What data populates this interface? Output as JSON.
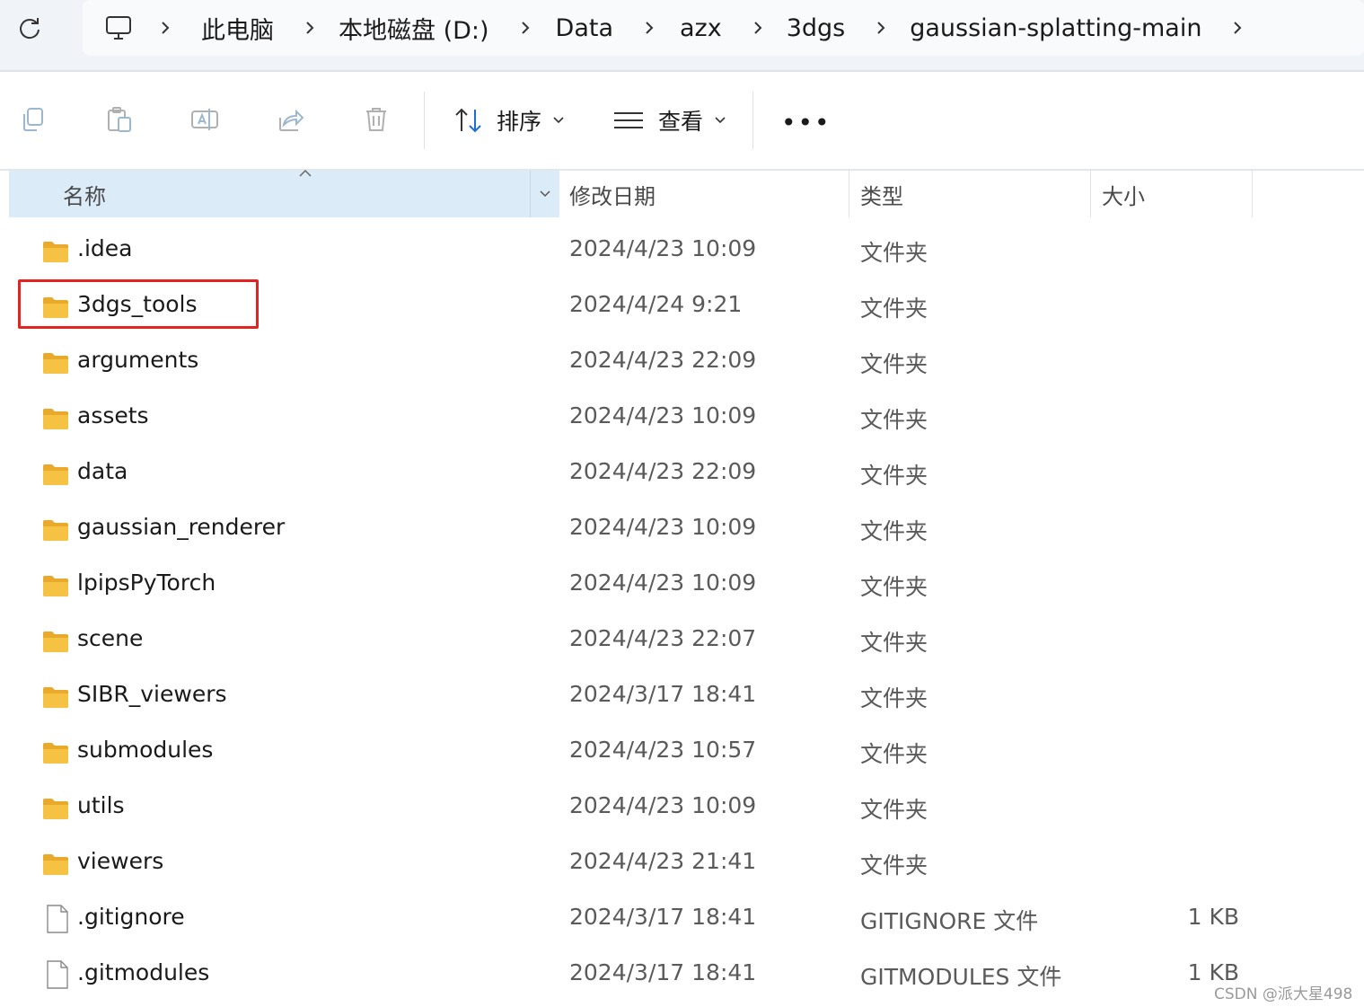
{
  "breadcrumb": {
    "items": [
      "此电脑",
      "本地磁盘 (D:)",
      "Data",
      "azx",
      "3dgs",
      "gaussian-splatting-main"
    ]
  },
  "toolbar": {
    "sort_label": "排序",
    "view_label": "查看",
    "more_label": "•••"
  },
  "columns": {
    "name": "名称",
    "date": "修改日期",
    "type": "类型",
    "size": "大小"
  },
  "rows": [
    {
      "name": ".idea",
      "date": "2024/4/23 10:09",
      "type": "文件夹",
      "size": "",
      "icon": "folder-icon"
    },
    {
      "name": "3dgs_tools",
      "date": "2024/4/24 9:21",
      "type": "文件夹",
      "size": "",
      "icon": "folder-icon"
    },
    {
      "name": "arguments",
      "date": "2024/4/23 22:09",
      "type": "文件夹",
      "size": "",
      "icon": "folder-icon"
    },
    {
      "name": "assets",
      "date": "2024/4/23 10:09",
      "type": "文件夹",
      "size": "",
      "icon": "folder-icon"
    },
    {
      "name": "data",
      "date": "2024/4/23 22:09",
      "type": "文件夹",
      "size": "",
      "icon": "folder-icon"
    },
    {
      "name": "gaussian_renderer",
      "date": "2024/4/23 10:09",
      "type": "文件夹",
      "size": "",
      "icon": "folder-icon"
    },
    {
      "name": "lpipsPyTorch",
      "date": "2024/4/23 10:09",
      "type": "文件夹",
      "size": "",
      "icon": "folder-icon"
    },
    {
      "name": "scene",
      "date": "2024/4/23 22:07",
      "type": "文件夹",
      "size": "",
      "icon": "folder-icon"
    },
    {
      "name": "SIBR_viewers",
      "date": "2024/3/17 18:41",
      "type": "文件夹",
      "size": "",
      "icon": "folder-icon"
    },
    {
      "name": "submodules",
      "date": "2024/4/23 10:57",
      "type": "文件夹",
      "size": "",
      "icon": "folder-icon"
    },
    {
      "name": "utils",
      "date": "2024/4/23 10:09",
      "type": "文件夹",
      "size": "",
      "icon": "folder-icon"
    },
    {
      "name": "viewers",
      "date": "2024/4/23 21:41",
      "type": "文件夹",
      "size": "",
      "icon": "folder-icon"
    },
    {
      "name": ".gitignore",
      "date": "2024/3/17 18:41",
      "type": "GITIGNORE 文件",
      "size": "1 KB",
      "icon": "file-icon"
    },
    {
      "name": ".gitmodules",
      "date": "2024/3/17 18:41",
      "type": "GITMODULES 文件",
      "size": "1 KB",
      "icon": "file-icon"
    }
  ],
  "watermark": "CSDN @派大星498",
  "colors": {
    "highlight": "#e4221f",
    "header_selected": "#dcebf8",
    "folder": "#f6c244"
  }
}
